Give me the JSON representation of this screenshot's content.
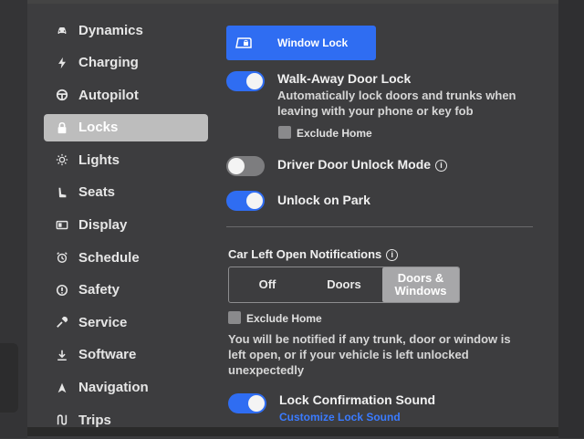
{
  "sidebar": {
    "items": [
      {
        "label": "Dynamics",
        "icon": "car-icon"
      },
      {
        "label": "Charging",
        "icon": "bolt-icon"
      },
      {
        "label": "Autopilot",
        "icon": "steering-wheel-icon"
      },
      {
        "label": "Locks",
        "icon": "lock-icon"
      },
      {
        "label": "Lights",
        "icon": "sun-icon"
      },
      {
        "label": "Seats",
        "icon": "seat-icon"
      },
      {
        "label": "Display",
        "icon": "display-icon"
      },
      {
        "label": "Schedule",
        "icon": "alarm-clock-icon"
      },
      {
        "label": "Safety",
        "icon": "alert-circle-icon"
      },
      {
        "label": "Service",
        "icon": "wrench-icon"
      },
      {
        "label": "Software",
        "icon": "download-icon"
      },
      {
        "label": "Navigation",
        "icon": "navigation-arrow-icon"
      },
      {
        "label": "Trips",
        "icon": "trips-icon"
      }
    ],
    "active": "Locks"
  },
  "locks": {
    "window_lock_label": "Window Lock",
    "walk_away": {
      "label": "Walk-Away Door Lock",
      "description": "Automatically lock doors and trunks when leaving with your phone or key fob",
      "enabled": true,
      "exclude_home_label": "Exclude Home"
    },
    "driver_door": {
      "label": "Driver Door Unlock Mode",
      "enabled": false
    },
    "unlock_on_park": {
      "label": "Unlock on Park",
      "enabled": true
    },
    "car_left_open": {
      "label": "Car Left Open Notifications",
      "options": [
        "Off",
        "Doors",
        "Doors & Windows"
      ],
      "selected": "Doors & Windows",
      "exclude_home_label": "Exclude Home",
      "description": "You will be notified if any trunk, door or window is left open, or if your vehicle is left unlocked unexpectedly"
    },
    "lock_sound": {
      "label": "Lock Confirmation Sound",
      "enabled": true,
      "link": "Customize Lock Sound"
    }
  },
  "colors": {
    "accent": "#2f6df2",
    "link": "#3a7bff"
  }
}
